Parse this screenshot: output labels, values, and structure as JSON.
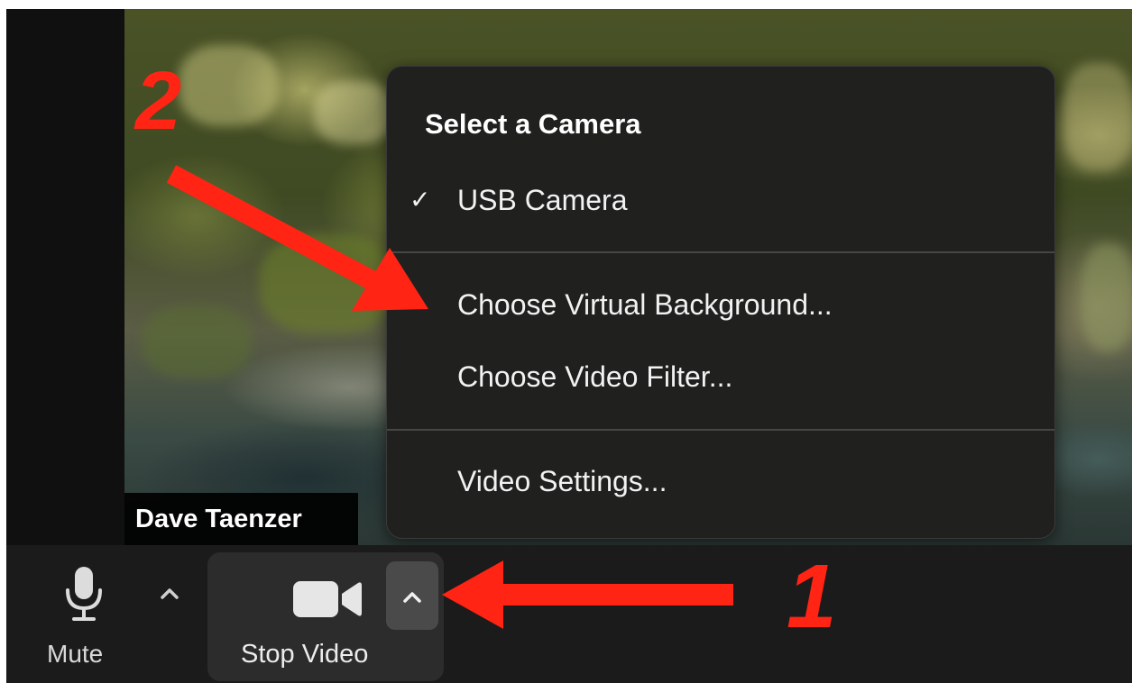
{
  "video": {
    "participant_name": "Dave Taenzer"
  },
  "camera_menu": {
    "header": "Select a Camera",
    "selected_camera": "USB Camera",
    "check_glyph": "✓",
    "items": [
      "Choose Virtual Background...",
      "Choose Video Filter...",
      "Video Settings..."
    ]
  },
  "toolbar": {
    "mute_label": "Mute",
    "mute_icon": "microphone-icon",
    "stop_video_label": "Stop Video",
    "video_icon": "video-camera-icon",
    "caret_icon": "chevron-up-icon"
  },
  "annotations": {
    "step1": "1",
    "step2": "2",
    "color": "#ff2414"
  }
}
